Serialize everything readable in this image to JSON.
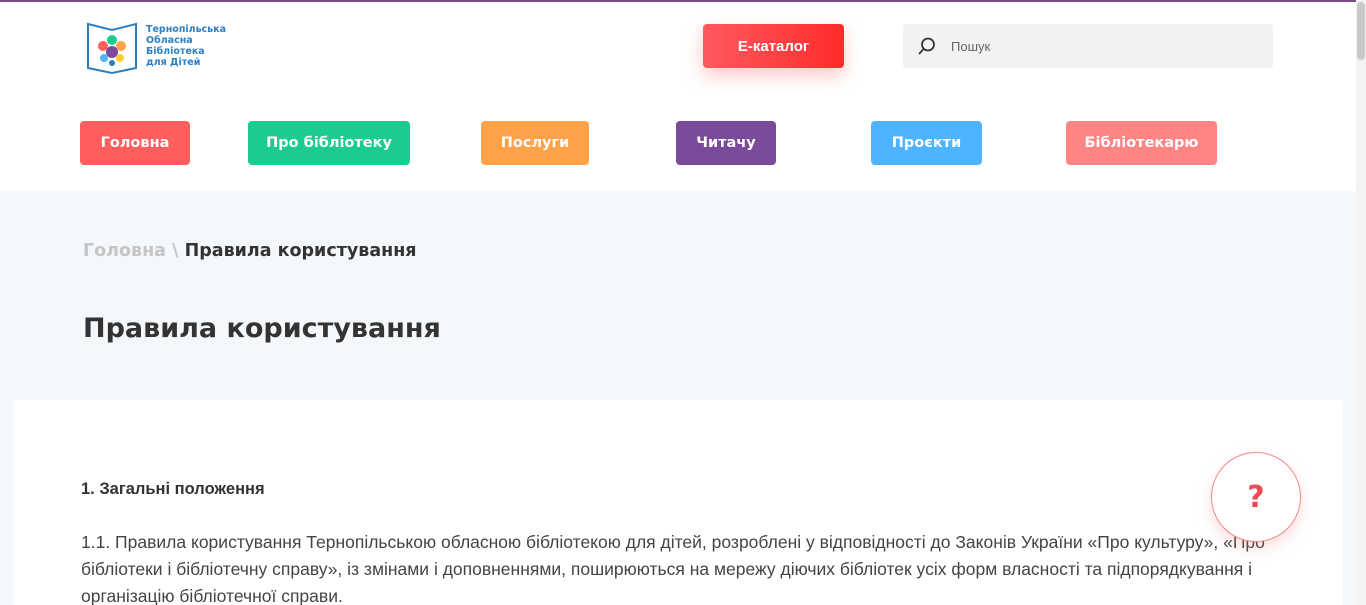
{
  "logo": {
    "lines": [
      "Тернопільська",
      "Обласна",
      "Бібліотека",
      "для Дітей"
    ]
  },
  "header": {
    "ecatalog_label": "Е-каталог",
    "search_placeholder": "Пошук"
  },
  "nav": [
    {
      "label": "Головна",
      "color": "#ff5e5e"
    },
    {
      "label": "Про бібліотеку",
      "color": "#1ccc8f"
    },
    {
      "label": "Послуги",
      "color": "#ffa24a"
    },
    {
      "label": "Читачу",
      "color": "#7b4a9a"
    },
    {
      "label": "Проєкти",
      "color": "#4fb4ff"
    },
    {
      "label": "Бібліотекарю",
      "color": "#ff8585"
    }
  ],
  "breadcrumb": {
    "home": "Головна",
    "separator": "\\",
    "current": "Правила користування"
  },
  "page": {
    "title": "Правила користування",
    "section_heading": "1. Загальні положення",
    "paragraph": "1.1. Правила користування Тернопільською обласною бібліотекою для дітей, розроблені у відповідності до Законів України «Про культуру», «Про бібліотеки і бібліотечну справу», із змінами і доповненнями, поширюються на мережу діючих бібліотек усіх форм власності та підпорядкування і організацію бібліотечної справи."
  },
  "help": {
    "glyph": "?",
    "icon": "question-icon"
  }
}
